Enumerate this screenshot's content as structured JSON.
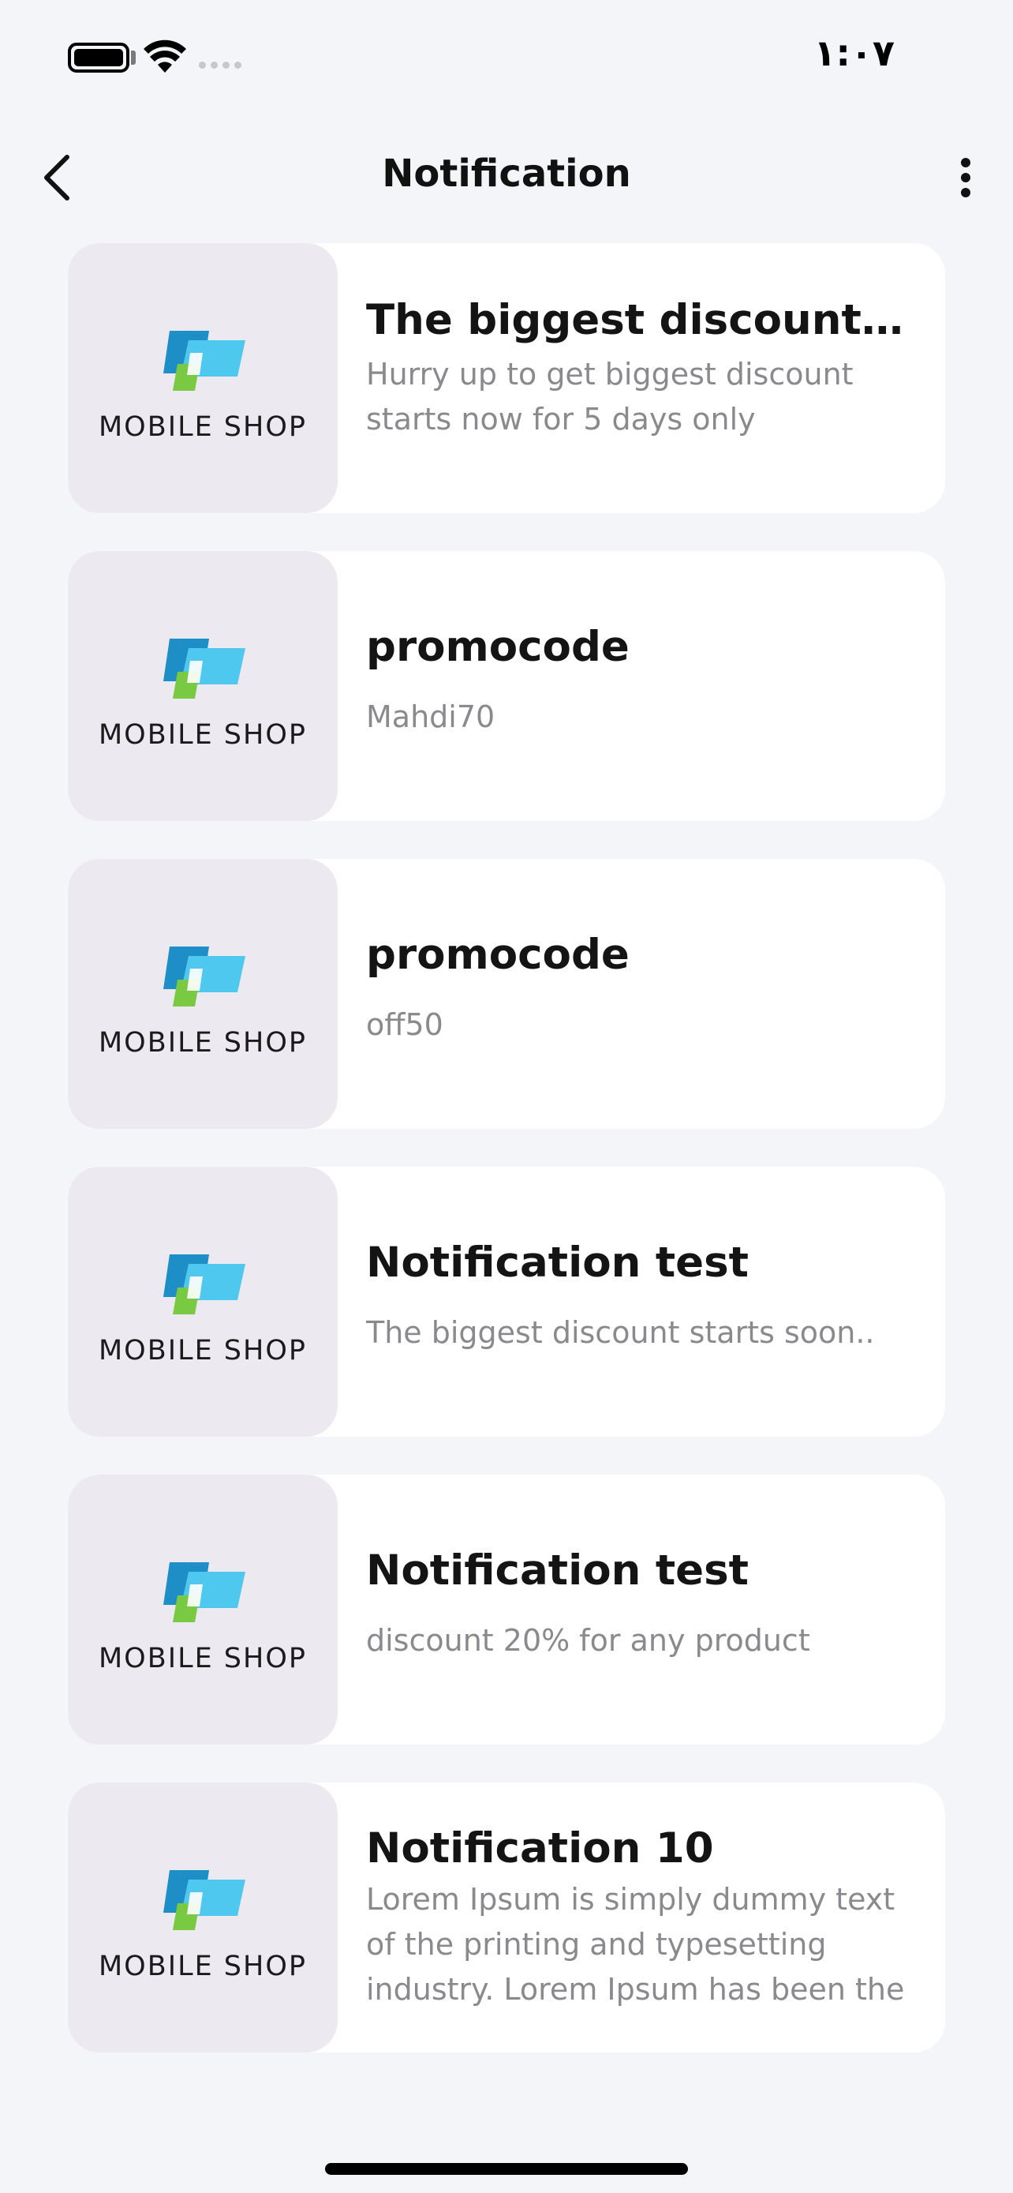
{
  "status_bar": {
    "time": "١:٠٧",
    "battery_icon": "battery-full-icon",
    "wifi_icon": "wifi-icon",
    "signal_icon": "cellular-signal-icon"
  },
  "nav": {
    "title": "Notification",
    "back_icon": "chevron-left-icon",
    "more_icon": "more-vertical-icon"
  },
  "brand": {
    "logo_text": "MOBILE SHOP",
    "colors": {
      "dark_blue": "#1e8fc6",
      "light_blue": "#4fc8f0",
      "green": "#7ac943"
    }
  },
  "notifications": [
    {
      "title": "The biggest discount starts now",
      "text": "Hurry up to get biggest discount starts now for 5 days only"
    },
    {
      "title": "promocode",
      "text": "Mahdi70"
    },
    {
      "title": "promocode",
      "text": "off50"
    },
    {
      "title": "Notification test",
      "text": "The biggest discount starts soon.."
    },
    {
      "title": "Notification test",
      "text": "discount 20% for any product"
    },
    {
      "title": "Notification 10",
      "text": "Lorem Ipsum is simply dummy text of the printing and typesetting industry. Lorem Ipsum has been the industry's standard dummy text"
    }
  ]
}
